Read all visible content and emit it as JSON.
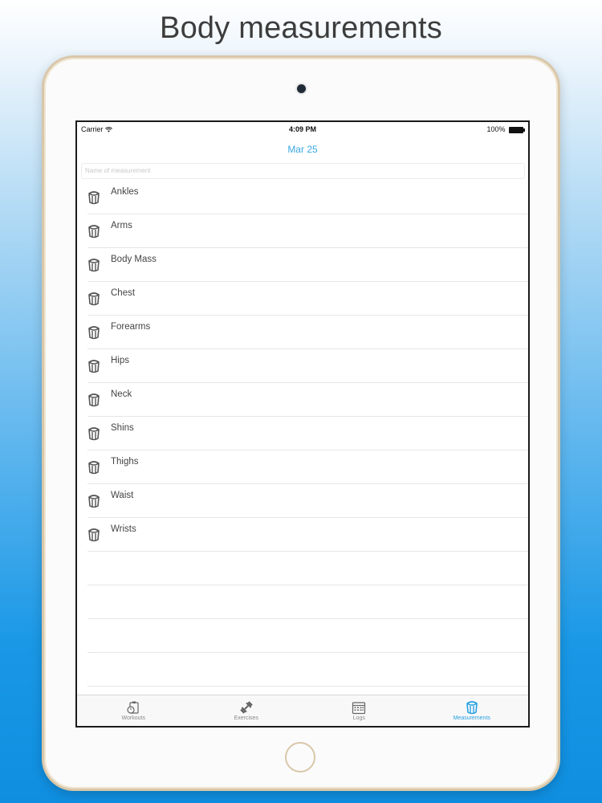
{
  "headline": "Body measurements",
  "status_bar": {
    "carrier": "Carrier",
    "time": "4:09 PM",
    "battery": "100%"
  },
  "nav": {
    "title": "Mar 25"
  },
  "search": {
    "placeholder": "Name of measurement"
  },
  "measurements": [
    "Ankles",
    "Arms",
    "Body Mass",
    "Chest",
    "Forearms",
    "Hips",
    "Neck",
    "Shins",
    "Thighs",
    "Waist",
    "Wrists"
  ],
  "empty_rows": 5,
  "tabs": [
    {
      "label": "Workouts",
      "icon": "stopwatch-clipboard-icon"
    },
    {
      "label": "Exercises",
      "icon": "dumbbell-icon"
    },
    {
      "label": "Logs",
      "icon": "calendar-icon"
    },
    {
      "label": "Measurements",
      "icon": "measuring-tape-icon"
    }
  ],
  "active_tab": 3,
  "colors": {
    "accent": "#2aa2e3",
    "text": "#444444",
    "tab_inactive": "#888888"
  }
}
